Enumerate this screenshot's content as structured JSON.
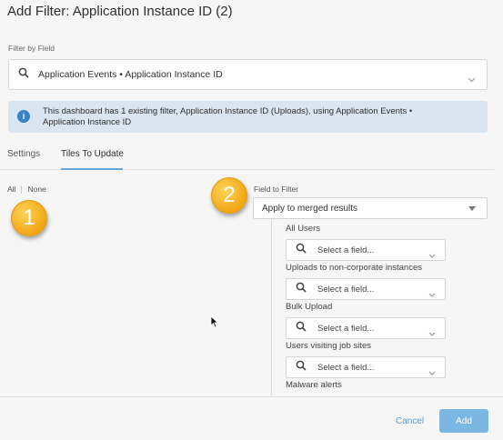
{
  "dialog": {
    "title": "Add Filter: Application Instance ID (2)"
  },
  "filter_by_field": {
    "label": "Filter by Field",
    "value": "Application Events • Application Instance ID"
  },
  "info_banner": {
    "line1": "This dashboard has 1 existing filter, Application Instance ID (Uploads), using Application Events •",
    "line2": "Application Instance ID"
  },
  "tabs": {
    "settings": "Settings",
    "tiles": "Tiles To Update",
    "active": "Tiles To Update"
  },
  "selection": {
    "all": "All",
    "none": "None"
  },
  "badges": {
    "one": "1",
    "two": "2"
  },
  "field_to_filter": {
    "label": "Field to Filter",
    "selected": "Apply to merged results"
  },
  "tiles": [
    {
      "name": "All Users",
      "placeholder": "Select a field..."
    },
    {
      "name": "Uploads to non-corporate instances",
      "placeholder": "Select a field..."
    },
    {
      "name": "Bulk Upload",
      "placeholder": "Select a field..."
    },
    {
      "name": "Users visiting job sites",
      "placeholder": "Select a field..."
    },
    {
      "name": "Malware alerts",
      "placeholder": ""
    }
  ],
  "footer": {
    "cancel": "Cancel",
    "add": "Add"
  },
  "colors": {
    "accent": "#6aa7d8",
    "badge": "#f1a613",
    "banner": "#d9e6f2",
    "add_button": "#7bb7e3"
  },
  "icons": {
    "info": "info-icon",
    "search": "search-icon",
    "chevron": "chevron-down-icon",
    "caret": "caret-down-icon",
    "cursor": "mouse-cursor-icon"
  }
}
